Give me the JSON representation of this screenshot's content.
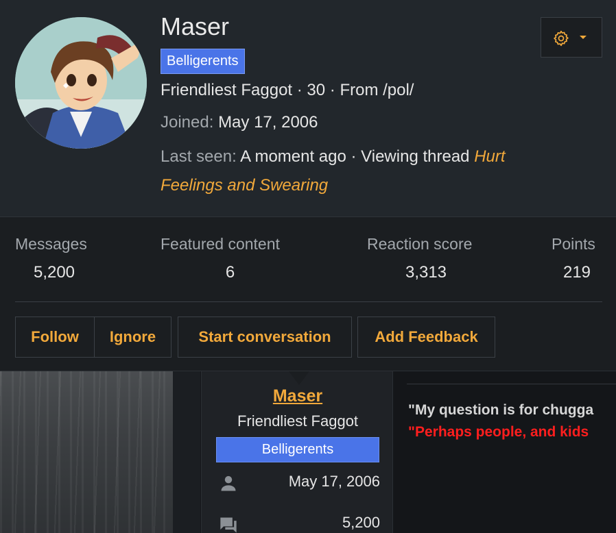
{
  "profile": {
    "name": "Maser",
    "group_badge": "Belligerents",
    "title_line": "Friendliest Faggot · 30 · From /pol/",
    "joined_label": "Joined:",
    "joined_value": "May 17, 2006",
    "last_seen_label": "Last seen:",
    "last_seen_value": "A moment ago · Viewing thread",
    "thread_title_part1": "Hurt",
    "thread_title_part2": "Feelings and Swearing"
  },
  "stats": [
    {
      "label": "Messages",
      "value": "5,200"
    },
    {
      "label": "Featured content",
      "value": "6"
    },
    {
      "label": "Reaction score",
      "value": "3,313"
    },
    {
      "label": "Points",
      "value": "219"
    }
  ],
  "actions": {
    "follow": "Follow",
    "ignore": "Ignore",
    "start_conversation": "Start conversation",
    "add_feedback": "Add Feedback"
  },
  "post": {
    "username": "Maser",
    "user_title": "Friendliest Faggot",
    "banner": "Belligerents",
    "joined": "May 17, 2006",
    "messages": "5,200",
    "quote_line1": "\"My question is for chugga",
    "quote_line2": "\"Perhaps people, and kids"
  },
  "colors": {
    "accent": "#f2a93b",
    "badge": "#4a74e8",
    "quote_red": "#ff1e1e"
  },
  "icons": {
    "gear": "gear-icon",
    "caret": "caret-down-icon",
    "user": "user-icon",
    "messages": "messages-icon"
  }
}
